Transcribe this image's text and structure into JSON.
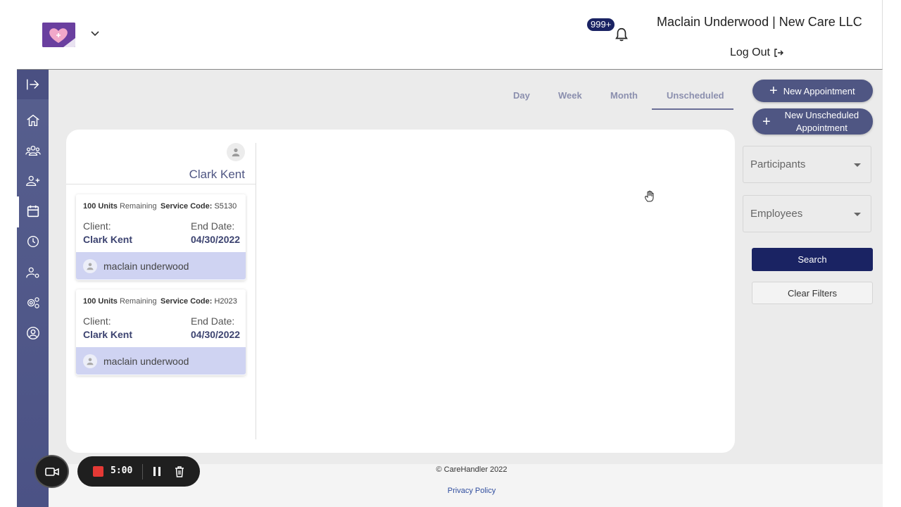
{
  "header": {
    "logo_icon": "heart-plus-logo",
    "notifications_count": "999+",
    "user_company": "Maclain Underwood | New Care LLC",
    "logout_label": "Log Out"
  },
  "sidebar": {
    "items": [
      {
        "icon": "collapse-arrow-icon"
      },
      {
        "icon": "home-icon"
      },
      {
        "icon": "group-icon"
      },
      {
        "icon": "add-user-icon"
      },
      {
        "icon": "calendar-icon",
        "active": true
      },
      {
        "icon": "clock-icon"
      },
      {
        "icon": "user-settings-icon"
      },
      {
        "icon": "gears-icon"
      },
      {
        "icon": "account-circle-icon"
      }
    ]
  },
  "tabs": [
    "Day",
    "Week",
    "Month",
    "Unscheduled"
  ],
  "active_tab": "Unscheduled",
  "actions": {
    "new_appointment": "New Appointment",
    "new_unscheduled_line1": "New Unscheduled",
    "new_unscheduled_line2": "Appointment"
  },
  "client": {
    "name": "Clark Kent"
  },
  "appointments": [
    {
      "units": "100 Units",
      "remaining": "Remaining",
      "service_code_label": "Service Code:",
      "service_code": "S5130",
      "client_label": "Client:",
      "client_name": "Clark Kent",
      "end_date_label": "End Date:",
      "end_date": "04/30/2022",
      "employee": "maclain underwood"
    },
    {
      "units": "100 Units",
      "remaining": "Remaining",
      "service_code_label": "Service Code:",
      "service_code": "H2023",
      "client_label": "Client:",
      "client_name": "Clark Kent",
      "end_date_label": "End Date:",
      "end_date": "04/30/2022",
      "employee": "maclain underwood"
    }
  ],
  "filters": {
    "participants_placeholder": "Participants",
    "employees_placeholder": "Employees",
    "search_label": "Search",
    "clear_label": "Clear Filters"
  },
  "footer": {
    "copyright": "© CareHandler 2022",
    "privacy": "Privacy Policy"
  },
  "recorder": {
    "time": "5:00"
  },
  "colors": {
    "brand_dark": "#1a2363",
    "sidebar": "#575f8e",
    "accent_pill": "#4f5683",
    "employee_band": "#cfd3f2"
  }
}
